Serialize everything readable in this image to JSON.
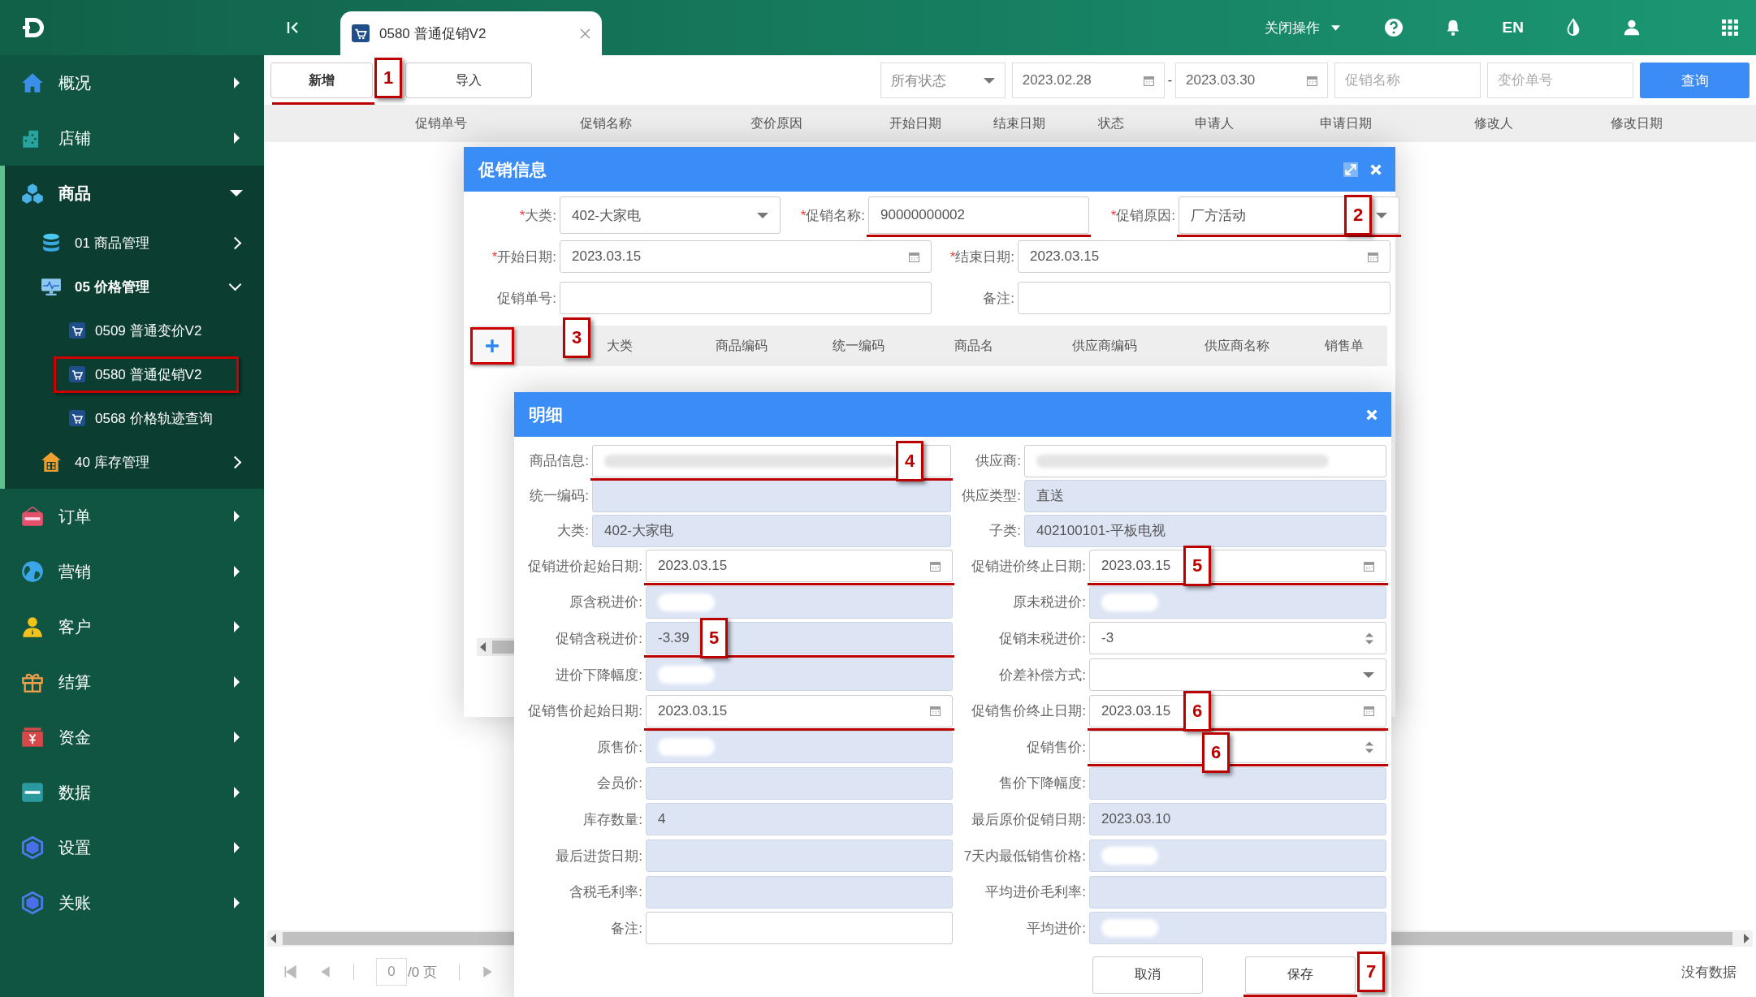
{
  "topbar": {
    "tab": {
      "label": "0580 普通促销V2"
    },
    "menu": "关闭操作",
    "language": "EN"
  },
  "sidebar": {
    "items": [
      {
        "label": "概况",
        "expanded": false
      },
      {
        "label": "店铺",
        "expanded": false
      },
      {
        "label": "商品",
        "expanded": true,
        "children": [
          {
            "label": "01 商品管理",
            "expanded": false
          },
          {
            "label": "05 价格管理",
            "expanded": true,
            "children": [
              {
                "label": "0509 普通变价V2",
                "highlighted": false
              },
              {
                "label": "0580 普通促销V2",
                "highlighted": true
              },
              {
                "label": "0568 价格轨迹查询",
                "highlighted": false
              }
            ]
          },
          {
            "label": "40 库存管理",
            "expanded": false
          }
        ]
      },
      {
        "label": "订单",
        "expanded": false
      },
      {
        "label": "营销",
        "expanded": false
      },
      {
        "label": "客户",
        "expanded": false
      },
      {
        "label": "结算",
        "expanded": false
      },
      {
        "label": "资金",
        "expanded": false
      },
      {
        "label": "数据",
        "expanded": false
      },
      {
        "label": "设置",
        "expanded": false
      },
      {
        "label": "关账",
        "expanded": false
      }
    ]
  },
  "toolbar": {
    "buttons": [
      {
        "label": "新增",
        "callout": "1"
      },
      {
        "label": "导入"
      }
    ],
    "status_filter": "所有状态",
    "date_from": "2023.02.28",
    "date_separator": "-",
    "date_to": "2023.03.30",
    "name_placeholder": "促销名称",
    "code_placeholder": "变价单号",
    "search": "查询"
  },
  "table": {
    "columns": [
      "促销单号",
      "促销名称",
      "变价原因",
      "开始日期",
      "结束日期",
      "状态",
      "申请人",
      "申请日期",
      "修改人",
      "修改日期"
    ]
  },
  "pager": {
    "page": "0",
    "total": "/0 页",
    "empty": "没有数据"
  },
  "promo_dialog": {
    "title": "促销信息",
    "required_mark": "*",
    "fields_top": [
      {
        "label": "大类:",
        "value": "402-大家电",
        "kind": "select",
        "required": true
      },
      {
        "label": "促销名称:",
        "value": "90000000002",
        "kind": "text",
        "required": true,
        "underline": true
      },
      {
        "label": "促销原因:",
        "value": "厂方活动",
        "kind": "select",
        "required": true,
        "callout": "2",
        "underline": true
      }
    ],
    "fields": [
      {
        "label": "开始日期:",
        "value": "2023.03.15",
        "kind": "date",
        "required": true
      },
      {
        "label": "结束日期:",
        "value": "2023.03.15",
        "kind": "date",
        "required": true
      },
      {
        "label": "促销单号:",
        "kind": "text",
        "required": false
      },
      {
        "label": "备注:",
        "kind": "text",
        "required": false
      }
    ],
    "add_callout": "3",
    "columns": [
      "大类",
      "商品编码",
      "统一编码",
      "商品名",
      "供应商编码",
      "供应商名称",
      "销售单"
    ]
  },
  "detail_dialog": {
    "title": "明细",
    "head_fields": [
      {
        "label": "商品信息:",
        "disabled": false,
        "redacted": true,
        "callout": "4",
        "underline": true
      },
      {
        "label": "供应商:",
        "disabled": false,
        "redacted": true
      },
      {
        "label": "统一编码:",
        "disabled": true,
        "redacted": false
      },
      {
        "label": "供应类型:",
        "value": "直送",
        "disabled": true,
        "redacted": false
      },
      {
        "label": "大类:",
        "value": "402-大家电",
        "disabled": true,
        "redacted": false
      },
      {
        "label": "子类:",
        "value": "402100101-平板电视",
        "disabled": true,
        "redacted": false
      }
    ],
    "fields": [
      {
        "label": "促销进价起始日期:",
        "value": "2023.03.15",
        "kind": "date",
        "disabled": false,
        "redacted": false,
        "underline": true
      },
      {
        "label": "促销进价终止日期:",
        "value": "2023.03.15",
        "kind": "date",
        "disabled": false,
        "redacted": false,
        "callout": "5",
        "underline": true
      },
      {
        "label": "原含税进价:",
        "kind": "text",
        "disabled": true,
        "redacted": true
      },
      {
        "label": "原未税进价:",
        "kind": "text",
        "disabled": true,
        "redacted": true
      },
      {
        "label": "促销含税进价:",
        "value": "-3.39",
        "kind": "text",
        "disabled": true,
        "redacted": false,
        "callout": "5",
        "underline": true
      },
      {
        "label": "促销未税进价:",
        "value": "-3",
        "kind": "spinner",
        "disabled": false,
        "redacted": false
      },
      {
        "label": "进价下降幅度:",
        "kind": "text",
        "disabled": true,
        "redacted": true
      },
      {
        "label": "价差补偿方式:",
        "kind": "select",
        "disabled": false,
        "redacted": false
      },
      {
        "label": "促销售价起始日期:",
        "value": "2023.03.15",
        "kind": "date",
        "disabled": false,
        "redacted": false,
        "underline": true
      },
      {
        "label": "促销售价终止日期:",
        "value": "2023.03.15",
        "kind": "date",
        "disabled": false,
        "redacted": false,
        "callout": "6",
        "underline": true
      },
      {
        "label": "原售价:",
        "kind": "text",
        "disabled": true,
        "redacted": true
      },
      {
        "label": "促销售价:",
        "kind": "spinner",
        "disabled": false,
        "redacted": false,
        "callout": "6",
        "underline": true
      },
      {
        "label": "会员价:",
        "kind": "text",
        "disabled": true,
        "redacted": false
      },
      {
        "label": "售价下降幅度:",
        "kind": "text",
        "disabled": true,
        "redacted": false
      },
      {
        "label": "库存数量:",
        "value": "4",
        "kind": "text",
        "disabled": true,
        "redacted": false
      },
      {
        "label": "最后原价促销日期:",
        "value": "2023.03.10",
        "kind": "text",
        "disabled": true,
        "redacted": false
      },
      {
        "label": "最后进货日期:",
        "kind": "text",
        "disabled": true,
        "redacted": false
      },
      {
        "label": "7天内最低销售价格:",
        "kind": "text",
        "disabled": true,
        "redacted": true
      },
      {
        "label": "含税毛利率:",
        "kind": "text",
        "disabled": true,
        "redacted": false
      },
      {
        "label": "平均进价毛利率:",
        "kind": "text",
        "disabled": true,
        "redacted": false
      },
      {
        "label": "备注:",
        "kind": "text",
        "disabled": false,
        "redacted": false
      },
      {
        "label": "平均进价:",
        "kind": "text",
        "disabled": true,
        "redacted": true
      }
    ],
    "buttons": [
      {
        "label": "取消"
      },
      {
        "label": "保存",
        "callout": "7",
        "underline": true
      }
    ]
  }
}
